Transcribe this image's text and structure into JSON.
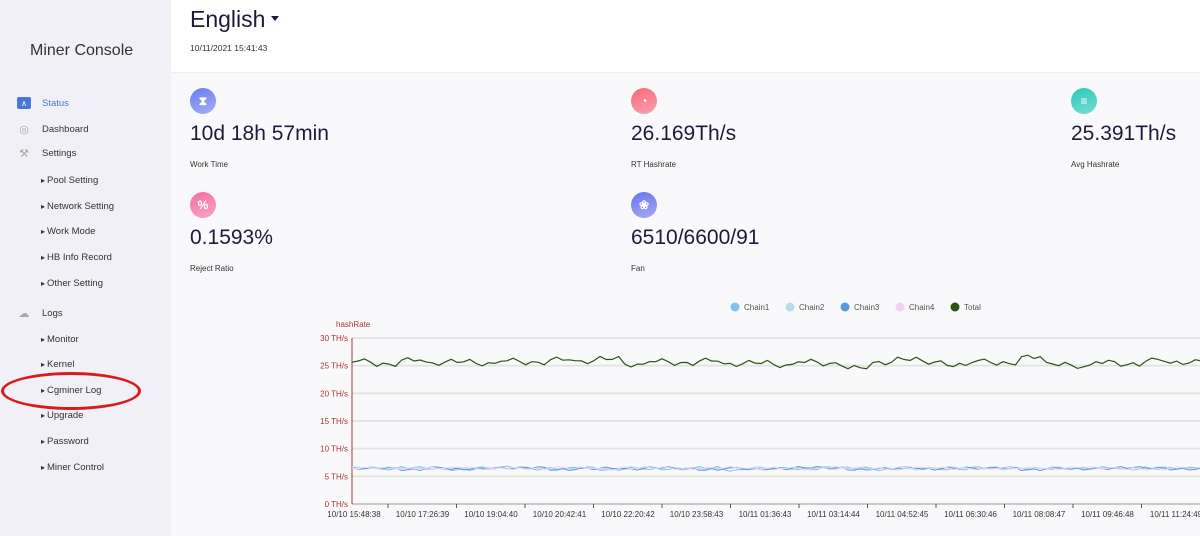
{
  "sidebar": {
    "title": "Miner Console",
    "items": [
      {
        "label": "Status",
        "icon": "monitor-icon",
        "active": true
      },
      {
        "label": "Dashboard",
        "icon": "dashboard-icon"
      },
      {
        "label": "Settings",
        "icon": "hammer-icon"
      },
      {
        "label": "Pool Setting",
        "sub": true
      },
      {
        "label": "Network Setting",
        "sub": true
      },
      {
        "label": "Work Mode",
        "sub": true
      },
      {
        "label": "HB Info Record",
        "sub": true
      },
      {
        "label": "Other Setting",
        "sub": true
      },
      {
        "label": "Logs",
        "icon": "cloud-icon"
      },
      {
        "label": "Monitor",
        "sub": true
      },
      {
        "label": "Kernel",
        "sub": true
      },
      {
        "label": "Cgminer Log",
        "sub": true,
        "highlighted": true
      },
      {
        "label": "Upgrade",
        "sub": true
      },
      {
        "label": "Password",
        "sub": true
      },
      {
        "label": "Miner Control",
        "sub": true
      }
    ]
  },
  "header": {
    "language": "English",
    "datetime": "10/11/2021 15:41:43"
  },
  "stats": [
    {
      "value": "10d 18h 57min",
      "label": "Work Time",
      "icon": "hourglass-icon",
      "color": "#6b7cf0"
    },
    {
      "value": "26.169Th/s",
      "label": "RT Hashrate",
      "icon": "speedometer-icon",
      "color": "#f6687a"
    },
    {
      "value": "25.391Th/s",
      "label": "Avg Hashrate",
      "icon": "server-icon",
      "color": "#27c9b8"
    },
    {
      "value": "0.1593%",
      "label": "Reject Ratio",
      "icon": "percent-icon",
      "color": "#f56ea0"
    },
    {
      "value": "6510/6600/91",
      "label": "Fan",
      "icon": "fan-icon",
      "color": "#6a74ee"
    }
  ],
  "chart_data": {
    "type": "line",
    "ylabel": "hashRate",
    "ylim": [
      0,
      30
    ],
    "yticks": [
      "0 TH/s",
      "5 TH/s",
      "10 TH/s",
      "15 TH/s",
      "20 TH/s",
      "25 TH/s",
      "30 TH/s"
    ],
    "xticks": [
      "10/10 15:48:38",
      "10/10 17:26:39",
      "10/10 19:04:40",
      "10/10 20:42:41",
      "10/10 22:20:42",
      "10/10 23:58:43",
      "10/11 01:36:43",
      "10/11 03:14:44",
      "10/11 04:52:45",
      "10/11 06:30:46",
      "10/11 08:08:47",
      "10/11 09:46:48",
      "10/11 11:24:49"
    ],
    "grid": true,
    "legend_position": "top",
    "series": [
      {
        "name": "Chain1",
        "color": "#7cc4f0",
        "values": [
          6.5,
          6.3,
          6.6,
          6.4,
          6.2,
          6.5,
          6.7,
          6.3,
          6.4,
          6.6,
          6.2,
          6.5,
          6.3,
          6.4,
          6.6,
          6.1,
          6.4,
          6.5,
          6.3,
          6.6,
          6.4,
          6.2,
          6.5,
          6.4,
          6.3,
          6.6,
          6.5,
          6.3,
          6.4,
          6.5,
          6.6,
          6.3,
          6.4,
          6.5,
          6.6,
          6.4
        ]
      },
      {
        "name": "Chain2",
        "color": "#b5dde6",
        "values": [
          6.6,
          6.4,
          6.5,
          6.3,
          6.5,
          6.6,
          6.4,
          6.5,
          6.3,
          6.5,
          6.4,
          6.6,
          6.5,
          6.3,
          6.4,
          6.5,
          6.6,
          6.3,
          6.5,
          6.4,
          6.6,
          6.5,
          6.3,
          6.5,
          6.6,
          6.4,
          6.3,
          6.5,
          6.6,
          6.4,
          6.5,
          6.3,
          6.6,
          6.4,
          6.5,
          6.5
        ]
      },
      {
        "name": "Chain3",
        "color": "#5b9bd5",
        "values": [
          6.4,
          6.5,
          6.2,
          6.6,
          6.3,
          6.4,
          6.5,
          6.6,
          6.2,
          6.4,
          6.5,
          6.3,
          6.6,
          6.4,
          6.2,
          6.5,
          6.3,
          6.4,
          6.6,
          6.5,
          6.2,
          6.4,
          6.6,
          6.3,
          6.5,
          6.4,
          6.6,
          6.2,
          6.5,
          6.3,
          6.4,
          6.6,
          6.5,
          6.3,
          6.4,
          6.3
        ]
      },
      {
        "name": "Chain4",
        "color": "#f0d0f5",
        "values": [
          6.5,
          6.6,
          6.4,
          6.5,
          6.6,
          6.3,
          6.5,
          6.4,
          6.6,
          6.5,
          6.3,
          6.5,
          6.6,
          6.4,
          6.5,
          6.6,
          6.4,
          6.5,
          6.3,
          6.6,
          6.5,
          6.4,
          6.6,
          6.5,
          6.4,
          6.3,
          6.6,
          6.5,
          6.4,
          6.6,
          6.5,
          6.4,
          6.3,
          6.6,
          6.5,
          6.4
        ]
      },
      {
        "name": "Total",
        "color": "#2e5214",
        "values": [
          25.9,
          25.2,
          26.1,
          25.4,
          25.8,
          25.3,
          26.0,
          25.5,
          26.2,
          25.7,
          26.3,
          25.1,
          25.9,
          25.4,
          26.0,
          25.2,
          25.6,
          25.0,
          25.8,
          25.3,
          24.7,
          25.5,
          26.2,
          25.6,
          25.1,
          25.9,
          25.4,
          26.6,
          25.3,
          24.8,
          25.7,
          25.2,
          26.1,
          25.5,
          25.8,
          25.3
        ]
      }
    ]
  }
}
